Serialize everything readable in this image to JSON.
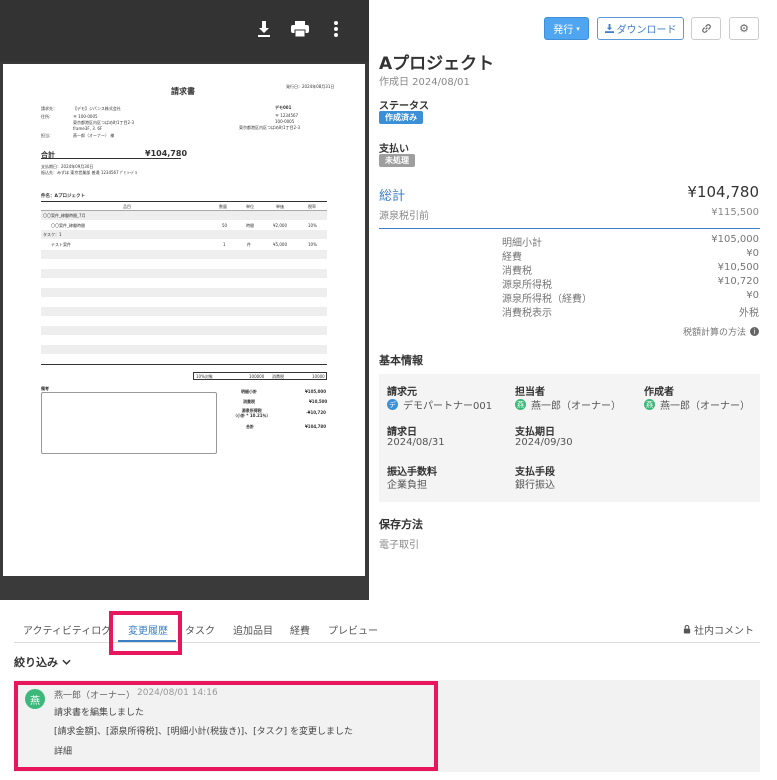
{
  "viewer": {
    "toolbar_icons": [
      "download-icon",
      "print-icon",
      "more-vert-icon"
    ],
    "doc": {
      "title": "請求書",
      "issue_date": "発行日：2024年08月31日",
      "to_label": "請求先：",
      "to_value": "【デモ】ジパンス株式会社",
      "address_label": "住所：",
      "address_lines": [
        "〒 100-0005",
        "東京都港区内区つばめ町1丁目2-3",
        "frame3F, 3. 6F"
      ],
      "contact_label": "担当：",
      "contact_value": "燕一郎（オーナー） 様",
      "right_title": "デモ001",
      "right_lines": [
        "〒 1234567",
        "100-0005",
        "東京都港区内区つばめ町1丁目2-3"
      ],
      "total_label": "合計",
      "total_value": "¥104,780",
      "due_line": "支払期日：2024年09月30日",
      "bank_line": "振込先：みずほ 東京営業部 普通 1234567 ｱﾞﾓ ｼｰﾃﾞﾙ",
      "subject": "件名：Aプロジェクト",
      "cols": [
        "品目",
        "数量",
        "単位",
        "単価",
        "税率"
      ],
      "rows": [
        {
          "name": "〇〇案件_稼働時間_7月",
          "qty": "",
          "unit": "",
          "price": "",
          "tax": ""
        },
        {
          "name": "〇〇案件_稼働時間",
          "qty": "50",
          "unit": "時間",
          "price": "¥2,000",
          "tax": "10%"
        },
        {
          "name": "タスク：1",
          "qty": "",
          "unit": "",
          "price": "",
          "tax": ""
        },
        {
          "name": "テスト案件",
          "qty": "1",
          "unit": "件",
          "price": "¥5,000",
          "tax": "10%"
        }
      ],
      "tax_summary": [
        "10%対象",
        "100000",
        "消費税",
        "10000"
      ],
      "notes_label": "備考",
      "summary": [
        {
          "label": "明細小計",
          "value": "¥105,000"
        },
        {
          "label": "消費税",
          "value": "¥10,500"
        },
        {
          "label": "源泉所得税\n（小計 * 10.21％）",
          "value": "-¥10,720"
        },
        {
          "label": "合計",
          "value": "¥104,780"
        }
      ]
    }
  },
  "actions": {
    "issue": "発行",
    "download": "ダウンロード"
  },
  "project": {
    "name": "Aプロジェクト",
    "created": "作成日 2024/08/01"
  },
  "status": {
    "label": "ステータス",
    "badge": "作成済み",
    "badge_color": "#3b8fd6"
  },
  "payment": {
    "label": "支払い",
    "badge": "未処理",
    "badge_color": "#9e9e9e"
  },
  "totals": {
    "total_label": "総計",
    "total_value": "¥104,780",
    "pre_label": "源泉税引前",
    "pre_value": "¥115,500",
    "breakdown": [
      {
        "label": "明細小計",
        "value": "¥105,000"
      },
      {
        "label": "経費",
        "value": "¥0"
      },
      {
        "label": "消費税",
        "value": "¥10,500"
      },
      {
        "label": "源泉所得税",
        "value": "¥10,720"
      },
      {
        "label": "源泉所得税（経費）",
        "value": "¥0"
      },
      {
        "label": "消費税表示",
        "value": "外税"
      }
    ],
    "tax_method": "税額計算の方法"
  },
  "basic": {
    "heading": "基本情報",
    "requester_label": "請求元",
    "requester": "デモパートナー001",
    "requester_avatar": "デ",
    "assignee_label": "担当者",
    "assignee": "燕一郎（オーナー）",
    "assignee_avatar": "燕",
    "creator_label": "作成者",
    "creator": "燕一郎（オーナー）",
    "creator_avatar": "燕",
    "invoice_date_label": "請求日",
    "invoice_date": "2024/08/31",
    "due_label": "支払期日",
    "due": "2024/09/30",
    "fee_label": "振込手数料",
    "fee": "企業負担",
    "method_label": "支払手段",
    "method": "銀行振込"
  },
  "storage": {
    "heading": "保存方法",
    "value": "電子取引"
  },
  "tabs": [
    "アクティビティログ",
    "変更履歴",
    "タスク",
    "追加品目",
    "経費",
    "プレビュー"
  ],
  "internal_comment": "社内コメント",
  "filter": "絞り込み",
  "activity": {
    "avatar": "燕",
    "user": "燕一郎（オーナー）",
    "time": "2024/08/01 14:16",
    "line1": "請求書を編集しました",
    "line2": "[請求金額]、[源泉所得税]、[明細小計(税抜き)]、[タスク] を変更しました",
    "detail": "詳細"
  }
}
